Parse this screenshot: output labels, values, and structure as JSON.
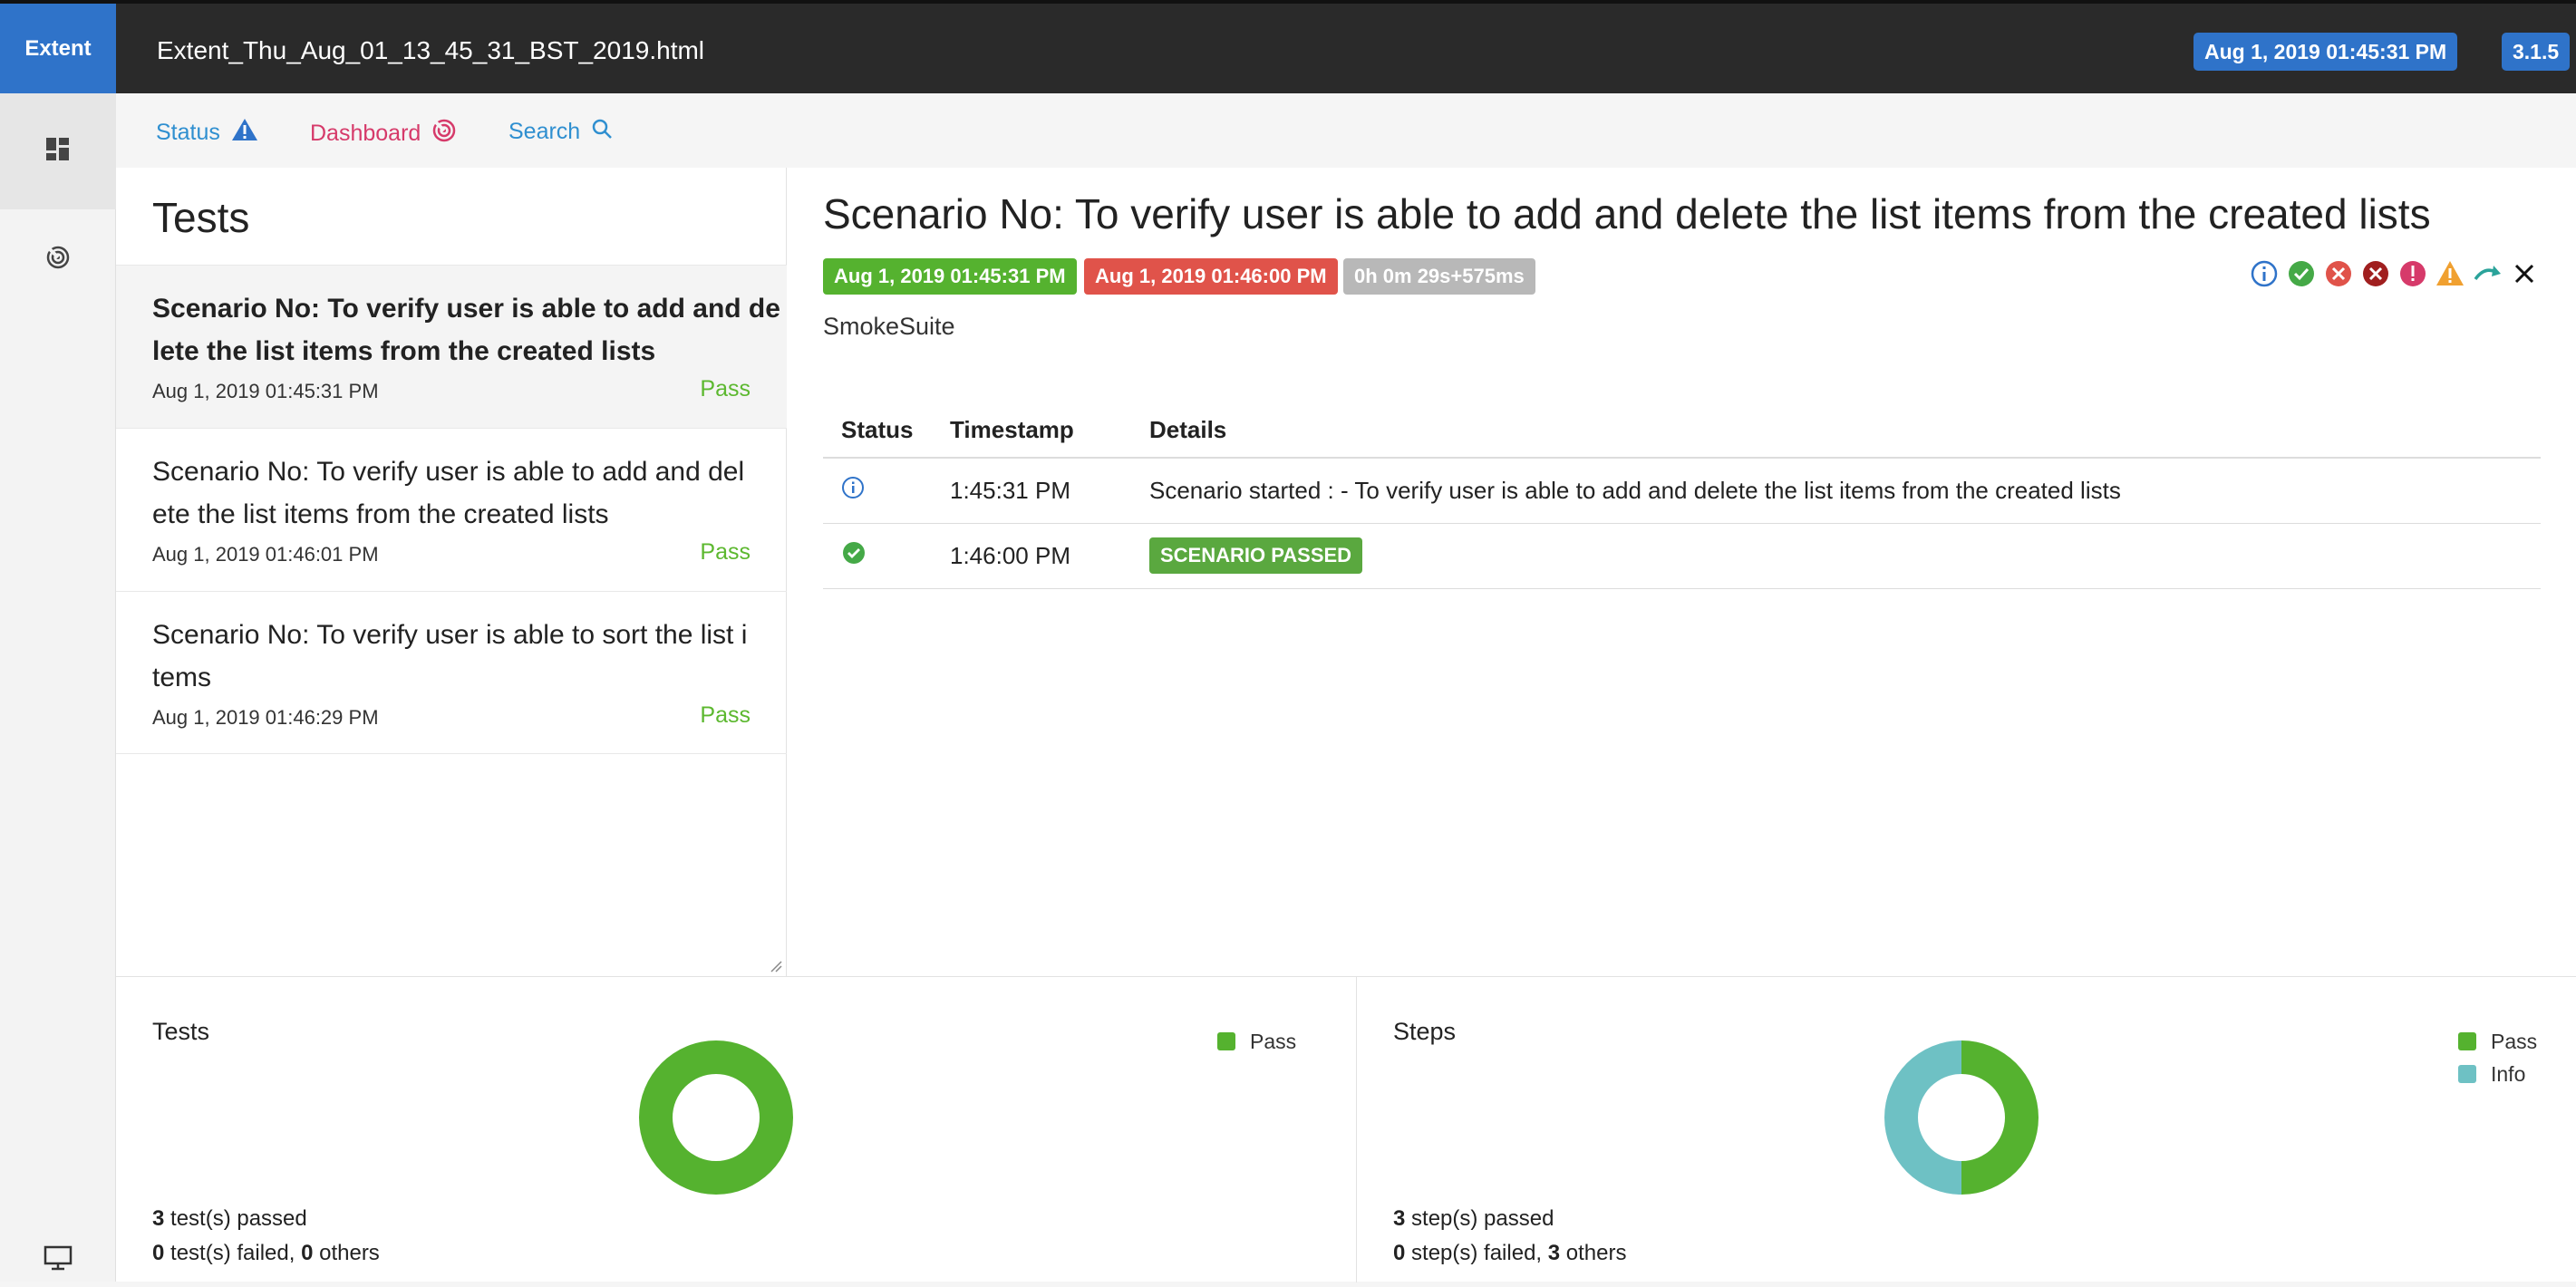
{
  "topbar": {
    "brand": "Extent",
    "report_name": "Extent_Thu_Aug_01_13_45_31_BST_2019.html",
    "timestamp_badge": "Aug 1, 2019 01:45:31 PM",
    "version_badge": "3.1.5"
  },
  "leftnav": {
    "items": [
      "dashboard-grid-icon",
      "radar-icon"
    ],
    "footer_icon": "monitor-icon"
  },
  "subnav": {
    "status": "Status",
    "dashboard": "Dashboard",
    "search": "Search"
  },
  "testlist": {
    "title": "Tests",
    "tests": [
      {
        "name": "Scenario No: To verify user is able to add and de lete the list items from the created lists",
        "time": "Aug 1, 2019 01:45:31 PM",
        "status": "Pass"
      },
      {
        "name": "Scenario No: To verify user is able to add and del ete the list items from the created lists",
        "time": "Aug 1, 2019 01:46:01 PM",
        "status": "Pass"
      },
      {
        "name": "Scenario No: To verify user is able to sort the list i tems",
        "time": "Aug 1, 2019 01:46:29 PM",
        "status": "Pass"
      }
    ]
  },
  "detail": {
    "title": "Scenario No: To verify user is able to add and delete the list items from the created lists",
    "start_time": "Aug 1, 2019 01:45:31 PM",
    "end_time": "Aug 1, 2019 01:46:00 PM",
    "duration": "0h 0m 29s+575ms",
    "category": "SmokeSuite",
    "columns": [
      "Status",
      "Timestamp",
      "Details"
    ],
    "logs": [
      {
        "status_icon": "info-icon",
        "time": "1:45:31 PM",
        "details": "Scenario started : - To verify user is able to add and delete the list items from the created lists"
      },
      {
        "status_icon": "pass-check-icon",
        "time": "1:46:00 PM",
        "details": "SCENARIO PASSED"
      }
    ],
    "filter_icons": [
      "info-icon",
      "pass-icon",
      "fail-icon",
      "fatal-icon",
      "error-icon",
      "warning-icon",
      "skip-icon",
      "clear-icon"
    ]
  },
  "charts": {
    "tests": {
      "title": "Tests",
      "legend": [
        "Pass"
      ],
      "summary_line1_count": "3",
      "summary_line1_text": " test(s) passed",
      "summary_line2_failed": "0",
      "summary_line2_mid": " test(s) failed, ",
      "summary_line2_others": "0",
      "summary_line2_end": " others"
    },
    "steps": {
      "title": "Steps",
      "legend": [
        "Pass",
        "Info"
      ],
      "summary_line1_count": "3",
      "summary_line1_text": " step(s) passed",
      "summary_line2_failed": "0",
      "summary_line2_mid": " step(s) failed, ",
      "summary_line2_others": "3",
      "summary_line2_end": " others"
    }
  },
  "chart_data": [
    {
      "type": "pie",
      "categories": [
        "Pass"
      ],
      "values": [
        3
      ]
    },
    {
      "type": "pie",
      "categories": [
        "Pass",
        "Info"
      ],
      "values": [
        1,
        1
      ]
    }
  ],
  "colors": {
    "pass": "#55b22f",
    "fail": "#e0534a",
    "info": "#6ec1c4",
    "accent": "#2f73c9",
    "warning": "#f0a030",
    "dashboard": "#d63a6a"
  }
}
